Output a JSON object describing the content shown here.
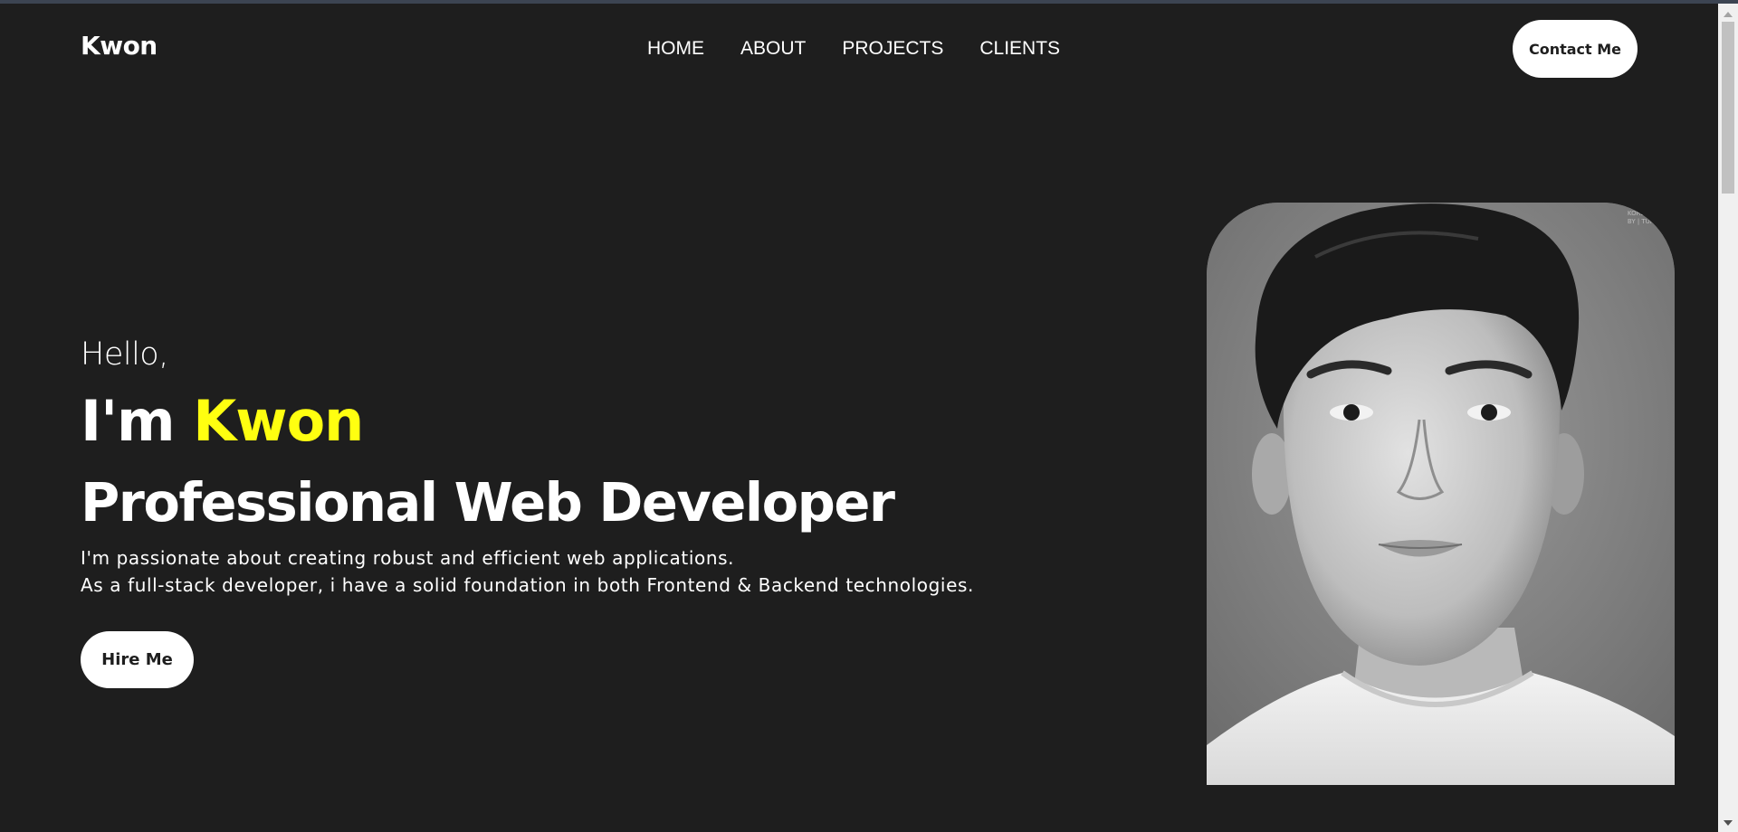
{
  "header": {
    "logo": "Kwon",
    "nav": [
      {
        "label": "HOME"
      },
      {
        "label": "ABOUT"
      },
      {
        "label": "PROJECTS"
      },
      {
        "label": "CLIENTS"
      }
    ],
    "contact_label": "Contact Me"
  },
  "hero": {
    "greeting": "Hello,",
    "intro_prefix": "I'm ",
    "name": "Kwon",
    "title": "Professional Web Developer",
    "description_line1": "I'm passionate about creating robust and efficient web applications.",
    "description_line2": "As a full-stack developer, i have a solid foundation in both Frontend & Backend technologies.",
    "hire_label": "Hire Me"
  },
  "portrait": {
    "credit_line1": "KOREA",
    "credit_line2": "BY | TUKK"
  },
  "colors": {
    "background": "#1e1e1e",
    "accent": "#ffff10",
    "text": "#ffffff",
    "button_bg": "#ffffff",
    "button_text": "#1e1e1e"
  },
  "icons": {
    "scroll_up": "scroll-up-arrow-icon",
    "scroll_down": "scroll-down-arrow-icon"
  }
}
